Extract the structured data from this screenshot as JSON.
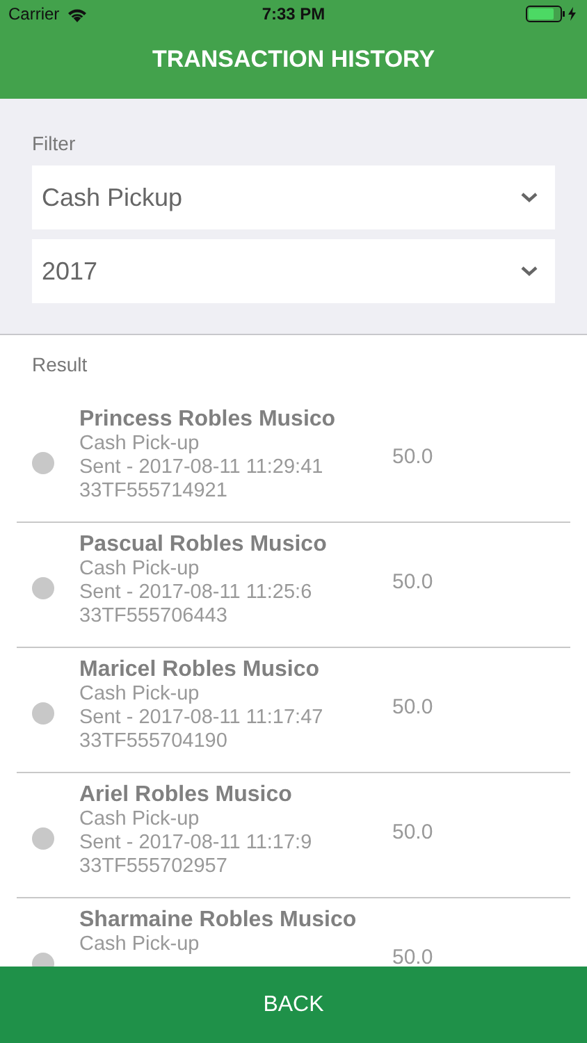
{
  "status_bar": {
    "carrier": "Carrier",
    "time": "7:33 PM"
  },
  "header": {
    "title": "TRANSACTION HISTORY"
  },
  "filter": {
    "label": "Filter",
    "dropdowns": [
      {
        "value": "Cash Pickup"
      },
      {
        "value": "2017"
      }
    ]
  },
  "result": {
    "label": "Result",
    "transactions": [
      {
        "name": "Princess Robles Musico",
        "type": "Cash Pick-up",
        "sent": "Sent - 2017-08-11 11:29:41",
        "reference": "33TF555714921",
        "amount": "50.0"
      },
      {
        "name": "Pascual Robles Musico",
        "type": "Cash Pick-up",
        "sent": "Sent - 2017-08-11 11:25:6",
        "reference": "33TF555706443",
        "amount": "50.0"
      },
      {
        "name": "Maricel Robles Musico",
        "type": "Cash Pick-up",
        "sent": "Sent - 2017-08-11 11:17:47",
        "reference": "33TF555704190",
        "amount": "50.0"
      },
      {
        "name": "Ariel Robles Musico",
        "type": "Cash Pick-up",
        "sent": "Sent - 2017-08-11 11:17:9",
        "reference": "33TF555702957",
        "amount": "50.0"
      },
      {
        "name": "Sharmaine Robles Musico",
        "type": "Cash Pick-up",
        "amount": "50.0"
      }
    ]
  },
  "back_button": {
    "label": "BACK"
  }
}
